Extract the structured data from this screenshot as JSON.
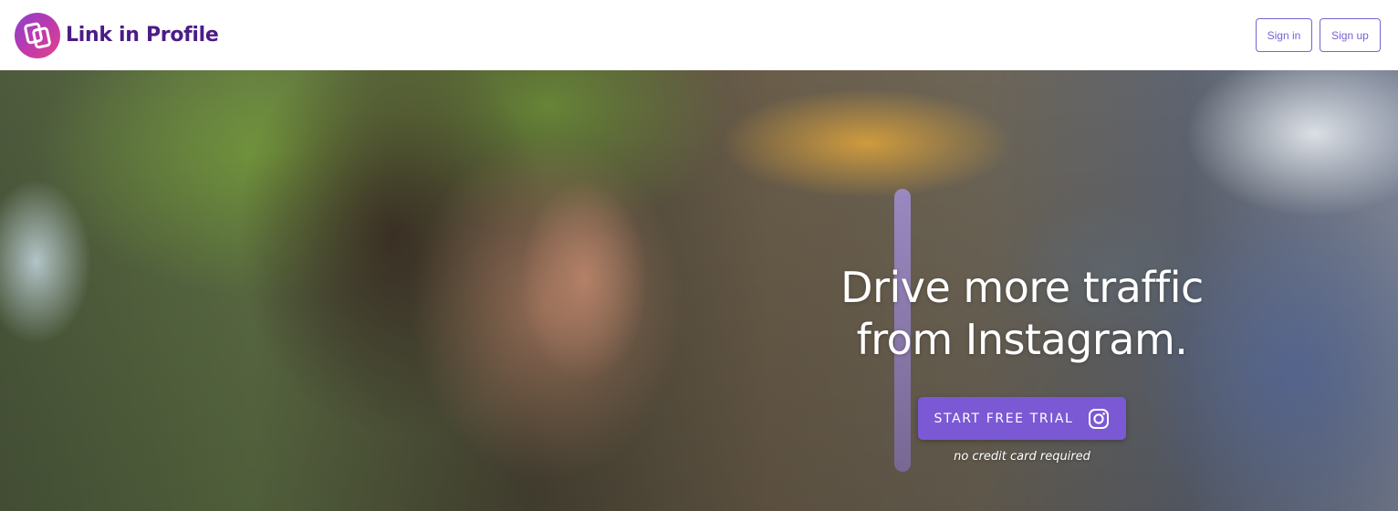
{
  "header": {
    "brand_name": "Link in Profile",
    "logo_icon": "link-in-profile-logo-icon",
    "signin_label": "Sign in",
    "signup_label": "Sign up"
  },
  "hero": {
    "headline_line1": "Drive more traffic",
    "headline_line2": "from Instagram.",
    "cta_label": "START FREE TRIAL",
    "cta_icon": "instagram-icon",
    "note": "no credit card required",
    "background_image": "woman-looking-down-through-window-photo"
  },
  "colors": {
    "brand_text": "#4b1c87",
    "accent": "#7b58d4",
    "button_border": "#7a61d1",
    "logo_gradient_start": "#8b3fd0",
    "logo_gradient_end": "#e0458e"
  }
}
